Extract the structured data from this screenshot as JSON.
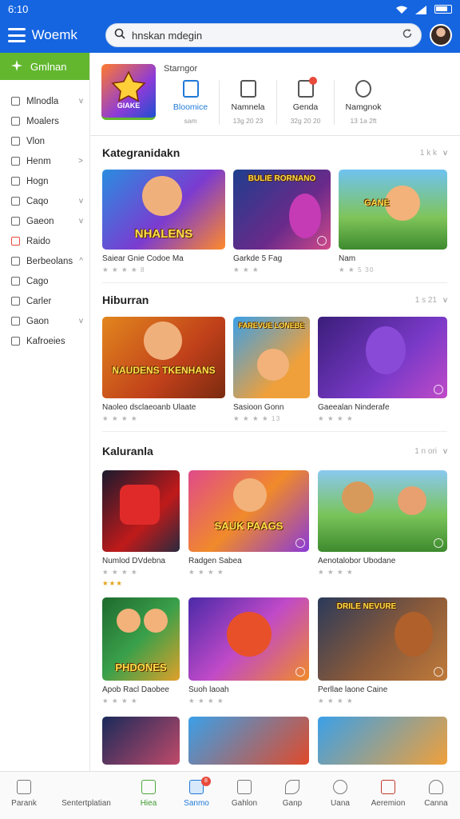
{
  "status": {
    "time": "6:10"
  },
  "app": {
    "title": "Woemk"
  },
  "search": {
    "value": "hnskan mdegin"
  },
  "sidebar": {
    "active": "Gmlnan",
    "items": [
      {
        "label": "Mlnodla",
        "chev": "v"
      },
      {
        "label": "Moalers",
        "chev": ""
      },
      {
        "label": "Vlon",
        "chev": ""
      },
      {
        "label": "Henm",
        "chev": ">"
      },
      {
        "label": "Hogn",
        "chev": ""
      },
      {
        "label": "Caqo",
        "chev": "v"
      },
      {
        "label": "Gaeon",
        "chev": "v"
      },
      {
        "label": "Raido",
        "chev": ""
      },
      {
        "label": "Berbeolans",
        "chev": "^"
      },
      {
        "label": "Cago",
        "chev": ""
      },
      {
        "label": "Carler",
        "chev": ""
      },
      {
        "label": "Gaon",
        "chev": "v"
      },
      {
        "label": "Kafroeies",
        "chev": ""
      }
    ]
  },
  "featured": {
    "title": "Starngor",
    "art_label": "GIAKE",
    "tabs": [
      {
        "label": "Bloomice",
        "sub": "sam"
      },
      {
        "label": "Namnela",
        "sub": "13g 20 23"
      },
      {
        "label": "Genda",
        "sub": "32g 20 20"
      },
      {
        "label": "Namgnok",
        "sub": "13 1a 2ft"
      }
    ]
  },
  "sections": [
    {
      "title": "Kategranidakn",
      "more": "1 k k",
      "cards": [
        {
          "name": "Saiear Gnie Codoe Ma",
          "stars": "★ ★ ★ ★ 8",
          "art": "NHALENS"
        },
        {
          "name": "Garkde 5 Fag",
          "stars": "★ ★ ★",
          "art": "BULIE RORNANO"
        },
        {
          "name": "Nam",
          "stars": "★ ★ 5 30",
          "art": "GANE"
        }
      ]
    },
    {
      "title": "Hiburran",
      "more": "1 s 21",
      "cards": [
        {
          "name": "Naoleo dsclaeoanb Ulaate",
          "stars": "★ ★ ★ ★",
          "art": "NAUDENS TKENHANS"
        },
        {
          "name": "Sasioon Gonn",
          "stars": "★ ★ ★ ★ 13",
          "art": "FAREVUE LONEBE"
        },
        {
          "name": "Gaeealan Ninderafe",
          "stars": "★ ★ ★ ★",
          "art": ""
        }
      ]
    },
    {
      "title": "Kaluranla",
      "more": "1 n ori",
      "cards": [
        {
          "name": "Numlod DVdebna",
          "stars": "★ ★ ★ ★",
          "gold": "★★★",
          "art": ""
        },
        {
          "name": "Radgen Sabea",
          "stars": "★ ★ ★ ★",
          "art": "SAUK PAAGS"
        },
        {
          "name": "Aenotalobor Ubodane",
          "stars": "★ ★ ★ ★",
          "art": ""
        },
        {
          "name": "Apob Racl Daobee",
          "stars": "★ ★ ★ ★",
          "art": "PHDONES"
        },
        {
          "name": "Suoh laoah",
          "stars": "★ ★ ★ ★",
          "art": ""
        },
        {
          "name": "Perllae laone Caine",
          "stars": "★ ★ ★ ★",
          "art": "DRILE NEVURE"
        }
      ]
    }
  ],
  "bottom_nav": [
    {
      "label": "Parank",
      "icon": "home-outline-icon"
    },
    {
      "label": "Sentertplatian",
      "icon": "blank"
    },
    {
      "label": "Hiea",
      "icon": "house-icon"
    },
    {
      "label": "Sanmo",
      "icon": "card-icon",
      "badge": "8"
    },
    {
      "label": "Gahlon",
      "icon": "calendar-icon"
    },
    {
      "label": "Ganp",
      "icon": "leaf-icon"
    },
    {
      "label": "Uana",
      "icon": "pen-icon"
    },
    {
      "label": "Aeremion",
      "icon": "frame-icon"
    },
    {
      "label": "Canna",
      "icon": "person-icon"
    }
  ],
  "colors": {
    "brand": "#1565e0",
    "accent_green": "#62b72f",
    "link_blue": "#1f7ad8",
    "badge_red": "#e84a3c"
  }
}
